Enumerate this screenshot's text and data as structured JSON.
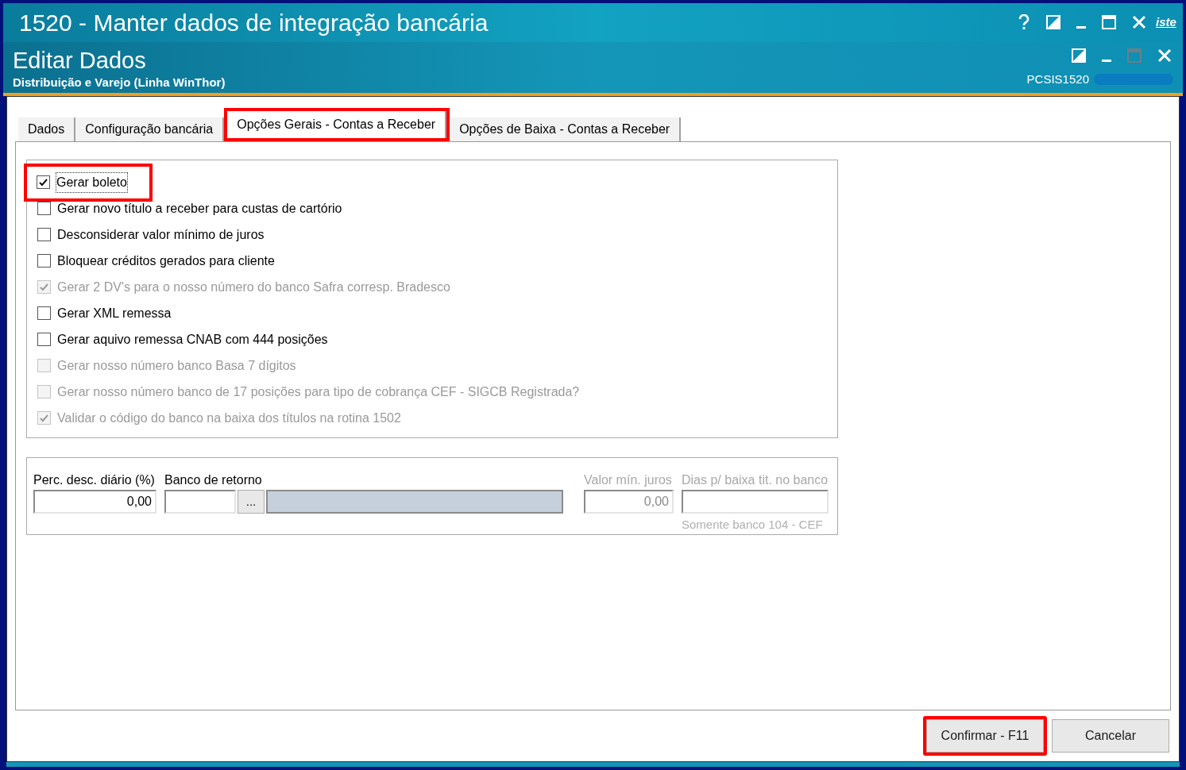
{
  "window": {
    "title": "1520 - Manter dados de integração bancária",
    "edge_text": "iste"
  },
  "header": {
    "title": "Editar Dados",
    "subtitle": "Distribuição e Varejo (Linha WinThor)",
    "code": "PCSIS1520"
  },
  "tabs": [
    {
      "label": "Dados",
      "selected": false,
      "highlighted": false
    },
    {
      "label": "Configuração bancária",
      "selected": false,
      "highlighted": false
    },
    {
      "label": "Opções Gerais - Contas a Receber",
      "selected": true,
      "highlighted": true
    },
    {
      "label": "Opções de Baixa - Contas a Receber",
      "selected": false,
      "highlighted": false
    }
  ],
  "options": [
    {
      "label": "Gerar boleto",
      "checked": true,
      "disabled": false,
      "highlighted": true
    },
    {
      "label": "Gerar novo título a receber para custas de cartório",
      "checked": false,
      "disabled": false,
      "highlighted": false
    },
    {
      "label": "Desconsiderar valor mínimo de juros",
      "checked": false,
      "disabled": false,
      "highlighted": false
    },
    {
      "label": "Bloquear créditos gerados para cliente",
      "checked": false,
      "disabled": false,
      "highlighted": false
    },
    {
      "label": "Gerar 2 DV's para o nosso número do banco Safra corresp. Bradesco",
      "checked": true,
      "disabled": true,
      "highlighted": false
    },
    {
      "label": "Gerar XML remessa",
      "checked": false,
      "disabled": false,
      "highlighted": false
    },
    {
      "label": "Gerar aquivo remessa CNAB com 444 posições",
      "checked": false,
      "disabled": false,
      "highlighted": false
    },
    {
      "label": "Gerar nosso número banco Basa 7 dígitos",
      "checked": false,
      "disabled": true,
      "highlighted": false
    },
    {
      "label": "Gerar nosso número banco de 17 posições para tipo de cobrança CEF - SIGCB Registrada?",
      "checked": false,
      "disabled": true,
      "highlighted": false
    },
    {
      "label": "Validar o código do banco na baixa dos títulos na rotina 1502",
      "checked": true,
      "disabled": true,
      "highlighted": false
    }
  ],
  "fields": [
    {
      "kind": "number",
      "label": "Perc. desc. diário (%)",
      "value": "0,00",
      "disabled": false
    },
    {
      "kind": "lookup",
      "label": "Banco de retorno",
      "button": "...",
      "disabled": false
    },
    {
      "kind": "number",
      "label": "Valor mín. juros",
      "value": "0,00",
      "disabled": true
    },
    {
      "kind": "text",
      "label": "Dias p/ baixa tit. no banco",
      "note": "Somente banco 104 - CEF",
      "disabled": true
    }
  ],
  "buttons": [
    {
      "label": "Confirmar - F11",
      "highlighted": true
    },
    {
      "label": "Cancelar",
      "highlighted": false
    }
  ]
}
